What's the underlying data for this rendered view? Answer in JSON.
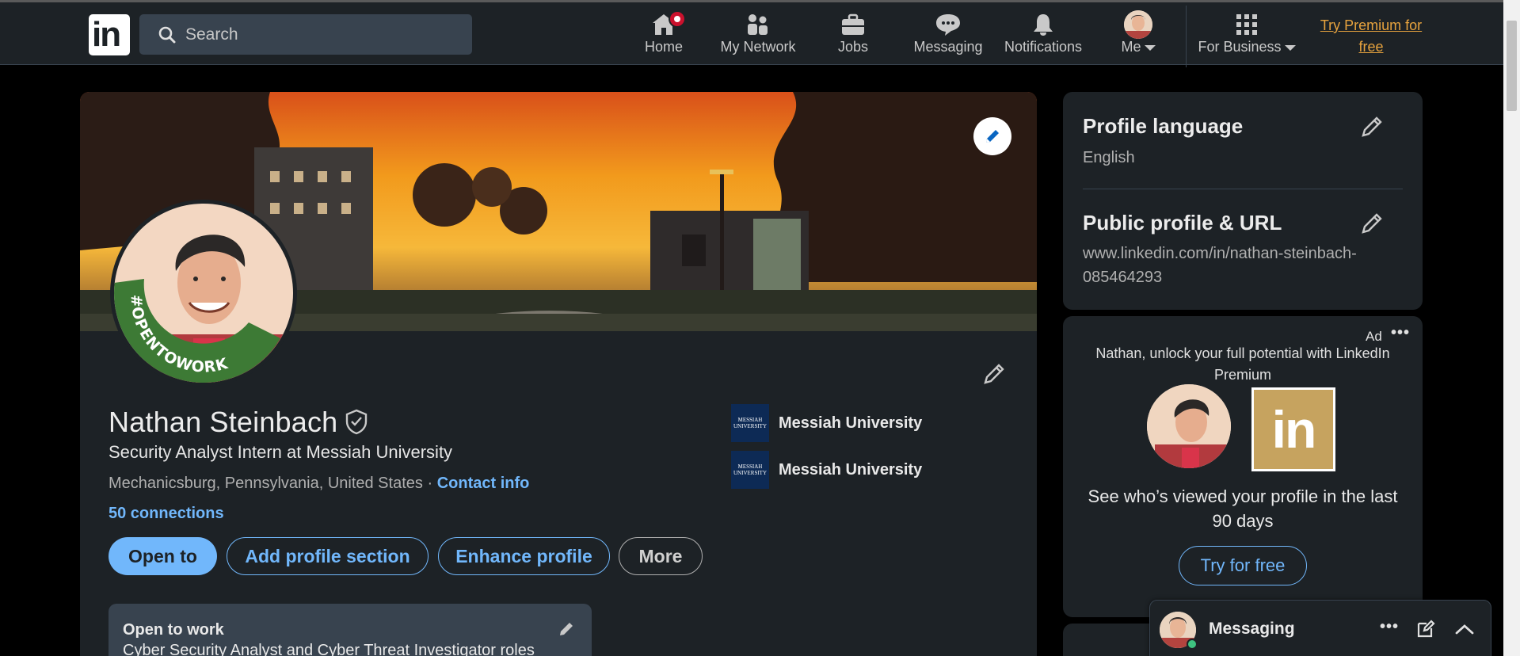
{
  "nav": {
    "search_placeholder": "Search",
    "items": [
      {
        "label": "Home",
        "icon": "home-icon"
      },
      {
        "label": "My Network",
        "icon": "people-icon"
      },
      {
        "label": "Jobs",
        "icon": "briefcase-icon"
      },
      {
        "label": "Messaging",
        "icon": "chat-icon"
      },
      {
        "label": "Notifications",
        "icon": "bell-icon"
      },
      {
        "label": "Me",
        "icon": "avatar"
      },
      {
        "label": "For Business",
        "icon": "grid-icon"
      }
    ],
    "premium_line1": "Try Premium for",
    "premium_line2": "free"
  },
  "profile": {
    "name": "Nathan Steinbach",
    "headline": "Security Analyst Intern at Messiah University",
    "location": "Mechanicsburg, Pennsylvania, United States",
    "separator": "·",
    "contact_label": "Contact info",
    "connections": "50 connections",
    "frame_text": "#OPENTOWORK",
    "buttons": {
      "open_to": "Open to",
      "add_section": "Add profile section",
      "enhance": "Enhance profile",
      "more": "More"
    },
    "education": [
      {
        "name": "Messiah University",
        "logo_text": "MESSIAH UNIVERSITY"
      },
      {
        "name": "Messiah University",
        "logo_text": "MESSIAH UNIVERSITY"
      }
    ],
    "open_to_work": {
      "title": "Open to work",
      "roles": "Cyber Security Analyst and Cyber Threat Investigator roles"
    }
  },
  "sidebar": {
    "language_title": "Profile language",
    "language_value": "English",
    "url_title": "Public profile & URL",
    "url_value_line1": "www.linkedin.com/in/nathan-steinbach-",
    "url_value_line2": "085464293"
  },
  "ad": {
    "label": "Ad",
    "copy": "Nathan, unlock your full potential with LinkedIn Premium",
    "main": "See who’s viewed your profile in the last 90 days",
    "cta": "Try for free"
  },
  "messaging": {
    "title": "Messaging"
  },
  "colors": {
    "nav_bg": "#1d2226",
    "card_bg": "#1d2226",
    "link_blue": "#71b7fb",
    "premium_gold": "#e7a33e",
    "notification_red": "#cb112d",
    "opentowork_green": "#4a8a3a"
  }
}
